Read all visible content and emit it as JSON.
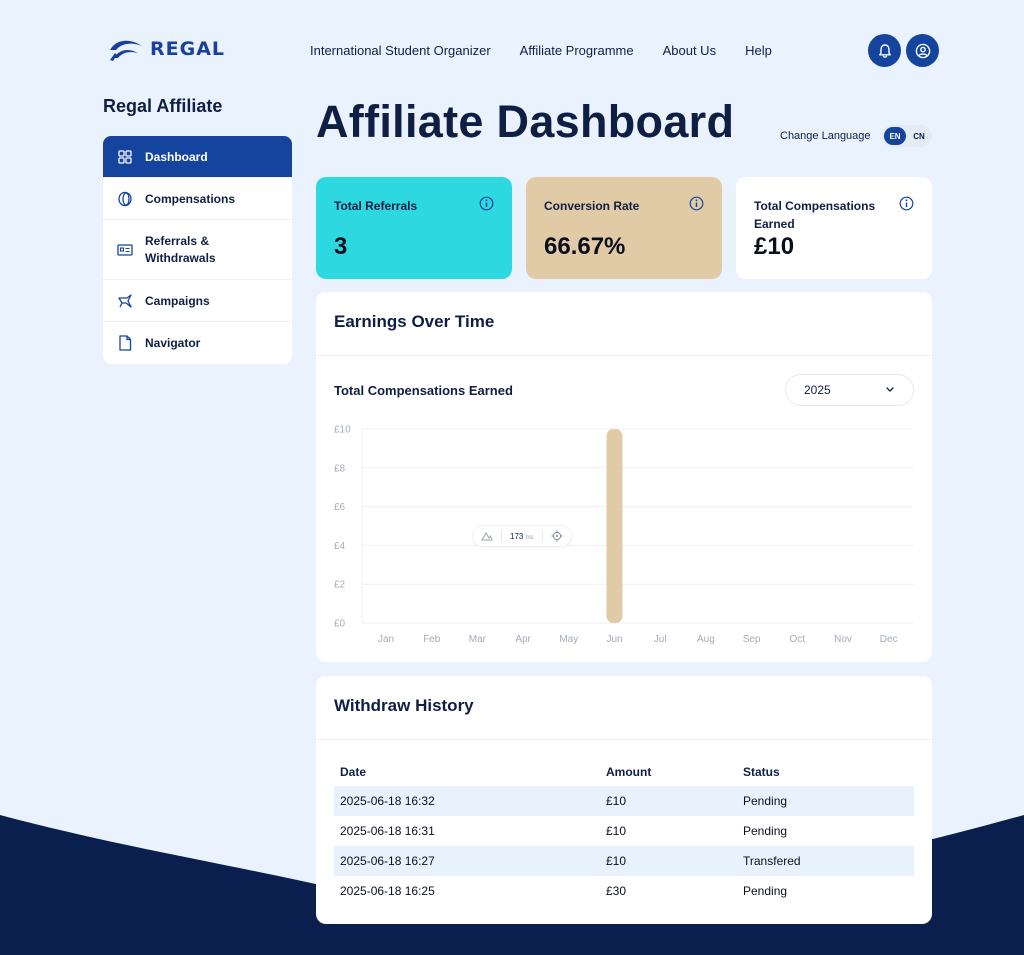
{
  "brand": {
    "name": "REGAL"
  },
  "nav": {
    "items": [
      "International Student Organizer",
      "Affiliate Programme",
      "About Us",
      "Help"
    ]
  },
  "icons": {
    "notifications": "bell-icon",
    "profile": "user-circle-icon"
  },
  "sidebar": {
    "title": "Regal Affiliate",
    "items": [
      {
        "label": "Dashboard",
        "icon": "grid-icon",
        "active": true
      },
      {
        "label": "Compensations",
        "icon": "coin-icon"
      },
      {
        "label": "Referrals &\nWithdrawals",
        "icon": "id-card-icon"
      },
      {
        "label": "Campaigns",
        "icon": "megaphone-icon"
      },
      {
        "label": "Navigator",
        "icon": "document-icon"
      }
    ]
  },
  "main": {
    "title": "Affiliate Dashboard",
    "language": {
      "label": "Change Language",
      "options": [
        "EN",
        "CN"
      ],
      "selected": "EN"
    }
  },
  "stats": [
    {
      "label": "Total Referrals",
      "value": "3",
      "color": "#2dd8e0"
    },
    {
      "label": "Conversion Rate",
      "value": "66.67%",
      "color": "#e1cba6"
    },
    {
      "label": "Total Compensations Earned",
      "value": "£10",
      "color": "#ffffff"
    }
  ],
  "earnings": {
    "title": "Earnings Over Time",
    "subtitle": "Total Compensations Earned",
    "year": "2025",
    "tooltip": {
      "value": "173",
      "unit": "ms"
    }
  },
  "chart_data": {
    "type": "bar",
    "categories": [
      "Jan",
      "Feb",
      "Mar",
      "Apr",
      "May",
      "Jun",
      "Jul",
      "Aug",
      "Sep",
      "Oct",
      "Nov",
      "Dec"
    ],
    "values": [
      0,
      0,
      0,
      0,
      0,
      10,
      0,
      0,
      0,
      0,
      0,
      0
    ],
    "yticks": [
      "£0",
      "£2",
      "£4",
      "£6",
      "£8",
      "£10"
    ],
    "ylim": [
      0,
      10
    ],
    "bar_color": "#e1cba6",
    "grid": true,
    "title": "",
    "xlabel": "",
    "ylabel": ""
  },
  "withdraw": {
    "title": "Withdraw History",
    "columns": [
      "Date",
      "Amount",
      "Status"
    ],
    "rows": [
      [
        "2025-06-18 16:32",
        "£10",
        "Pending"
      ],
      [
        "2025-06-18 16:31",
        "£10",
        "Pending"
      ],
      [
        "2025-06-18 16:27",
        "£10",
        "Transfered"
      ],
      [
        "2025-06-18 16:25",
        "£30",
        "Pending"
      ]
    ]
  },
  "colors": {
    "primary": "#15449e",
    "navy": "#0f1f44",
    "background": "#eaf3fd",
    "footer": "#0a1f4d"
  }
}
